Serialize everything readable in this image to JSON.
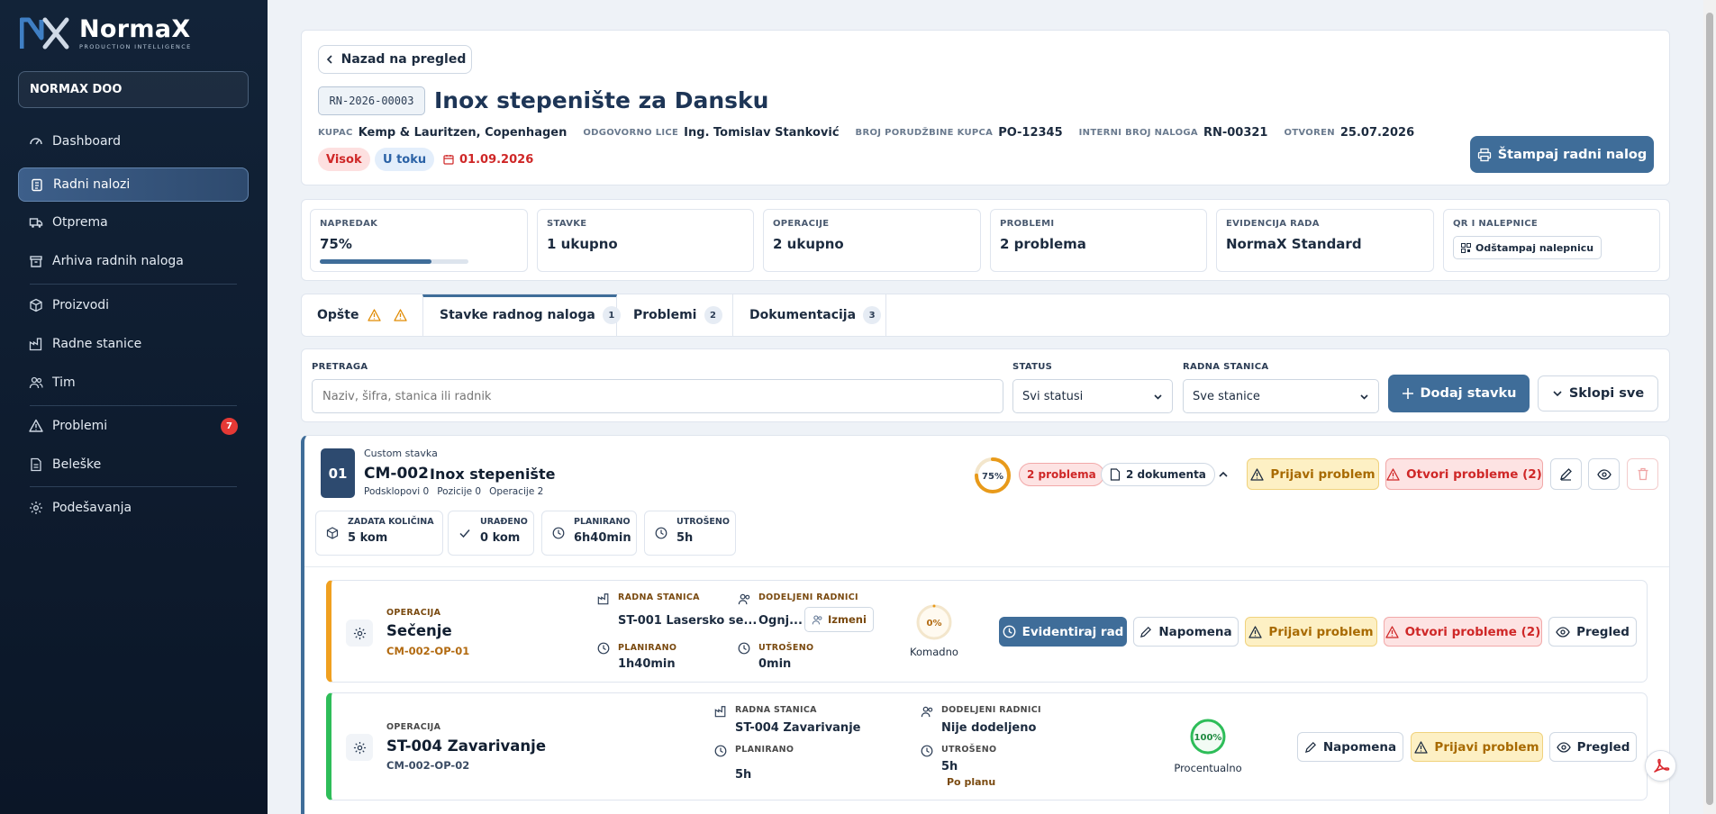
{
  "brand": {
    "name": "NormaX",
    "tagline": "PRODUCTION INTELLIGENCE",
    "company": "NORMAX DOO"
  },
  "nav": [
    {
      "label": "Dashboard",
      "icon": "gauge-icon"
    },
    {
      "label": "Radni nalozi",
      "icon": "clipboard-icon",
      "active": true
    },
    {
      "label": "Otprema",
      "icon": "truck-icon"
    },
    {
      "label": "Arhiva radnih naloga",
      "icon": "archive-icon"
    },
    {
      "label": "Proizvodi",
      "icon": "box-icon"
    },
    {
      "label": "Radne stanice",
      "icon": "factory-icon"
    },
    {
      "label": "Tim",
      "icon": "users-icon"
    },
    {
      "label": "Problemi",
      "icon": "warning-icon",
      "badge": "7"
    },
    {
      "label": "Beleške",
      "icon": "note-icon"
    },
    {
      "label": "Podešavanja",
      "icon": "gear-icon"
    }
  ],
  "header": {
    "back_label": "Nazad na pregled",
    "code": "RN-2026-00003",
    "title": "Inox stepenište za Dansku",
    "meta": [
      {
        "label": "KUPAC",
        "value": "Kemp & Lauritzen, Copenhagen"
      },
      {
        "label": "ODGOVORNO LICE",
        "value": "Ing. Tomislav Stanković"
      },
      {
        "label": "BROJ PORUDŽBINE KUPCA",
        "value": "PO-12345"
      },
      {
        "label": "INTERNI BROJ NALOGA",
        "value": "RN-00321"
      },
      {
        "label": "OTVOREN",
        "value": "25.07.2026"
      }
    ],
    "priority": "Visok",
    "status": "U toku",
    "due_date": "01.09.2026",
    "print_label": "Štampaj radni nalog",
    "colors": {
      "accent": "#3f6d99",
      "danger": "#cf2727",
      "warning": "#a86a00"
    }
  },
  "stats": {
    "progress": {
      "label": "NAPREDAK",
      "value": "75%",
      "fraction": 0.75
    },
    "items": {
      "label": "STAVKE",
      "value": "1 ukupno"
    },
    "operations": {
      "label": "OPERACIJE",
      "value": "2 ukupno"
    },
    "problems": {
      "label": "PROBLEMI",
      "value": "2 problema"
    },
    "tracking": {
      "label": "EVIDENCIJA RADA",
      "value": "NormaX Standard"
    },
    "qr": {
      "label": "QR I NALEPNICE",
      "button": "Odštampaj nalepnicu"
    }
  },
  "tabs": [
    {
      "label": "Opšte"
    },
    {
      "label": "Stavke radnog naloga",
      "count": "1",
      "active": true
    },
    {
      "label": "Problemi",
      "count": "2"
    },
    {
      "label": "Dokumentacija",
      "count": "3"
    }
  ],
  "filters": {
    "search_label": "PRETRAGA",
    "search_placeholder": "Naziv, šifra, stanica ili radnik",
    "status_label": "STATUS",
    "status_value": "Svi statusi",
    "station_label": "RADNA STANICA",
    "station_value": "Sve stanice",
    "add_label": "Dodaj stavku",
    "collapse_label": "Sklopi sve"
  },
  "item": {
    "index": "01",
    "type": "Custom stavka",
    "code": "CM-002",
    "name": "Inox stepenište",
    "sub": [
      "Podsklopovi 0",
      "Pozicije 0",
      "Operacije 2"
    ],
    "progress": "75%",
    "progress_fraction": 0.75,
    "problems": "2 problema",
    "documents": "2 dokumenta",
    "report_label": "Prijavi problem",
    "open_problems_label": "Otvori probleme (2)",
    "metrics": [
      {
        "label": "ZADATA KOLIČINA",
        "value": "5 kom"
      },
      {
        "label": "URAĐENO",
        "value": "0 kom"
      },
      {
        "label": "PLANIRANO",
        "value": "6h40min"
      },
      {
        "label": "UTROŠENO",
        "value": "5h"
      }
    ]
  },
  "operations": [
    {
      "type_label": "OPERACIJA",
      "name": "Sečenje",
      "code": "CM-002-OP-01",
      "station_label": "RADNA STANICA",
      "station": "ST-001 Lasersko se...",
      "workers_label": "DODELJENI RADNICI",
      "workers": "Ognj...",
      "edit_label": "Izmeni",
      "planned_label": "PLANIRANO",
      "planned": "1h40min",
      "spent_label": "UTROŠENO",
      "spent": "0min",
      "progress": "0%",
      "progress_fraction": 0,
      "mode": "Komadno",
      "track_label": "Evidentiraj rad",
      "note_label": "Napomena",
      "report_label": "Prijavi problem",
      "open_label": "Otvori probleme (2)",
      "view_label": "Pregled",
      "accent": "#f0a020"
    },
    {
      "type_label": "OPERACIJA",
      "name": "ST-004 Zavarivanje",
      "code": "CM-002-OP-02",
      "station_label": "RADNA STANICA",
      "station": "ST-004 Zavarivanje",
      "workers_label": "DODELJENI RADNICI",
      "workers": "Nije dodeljeno",
      "planned_label": "PLANIRANO",
      "planned": "5h",
      "spent_label": "UTROŠENO",
      "spent": "5h",
      "spent_note": "Po planu",
      "progress": "100%",
      "progress_fraction": 1,
      "mode": "Procentualno",
      "note_label": "Napomena",
      "report_label": "Prijavi problem",
      "view_label": "Pregled",
      "accent": "#2ebd59"
    }
  ]
}
